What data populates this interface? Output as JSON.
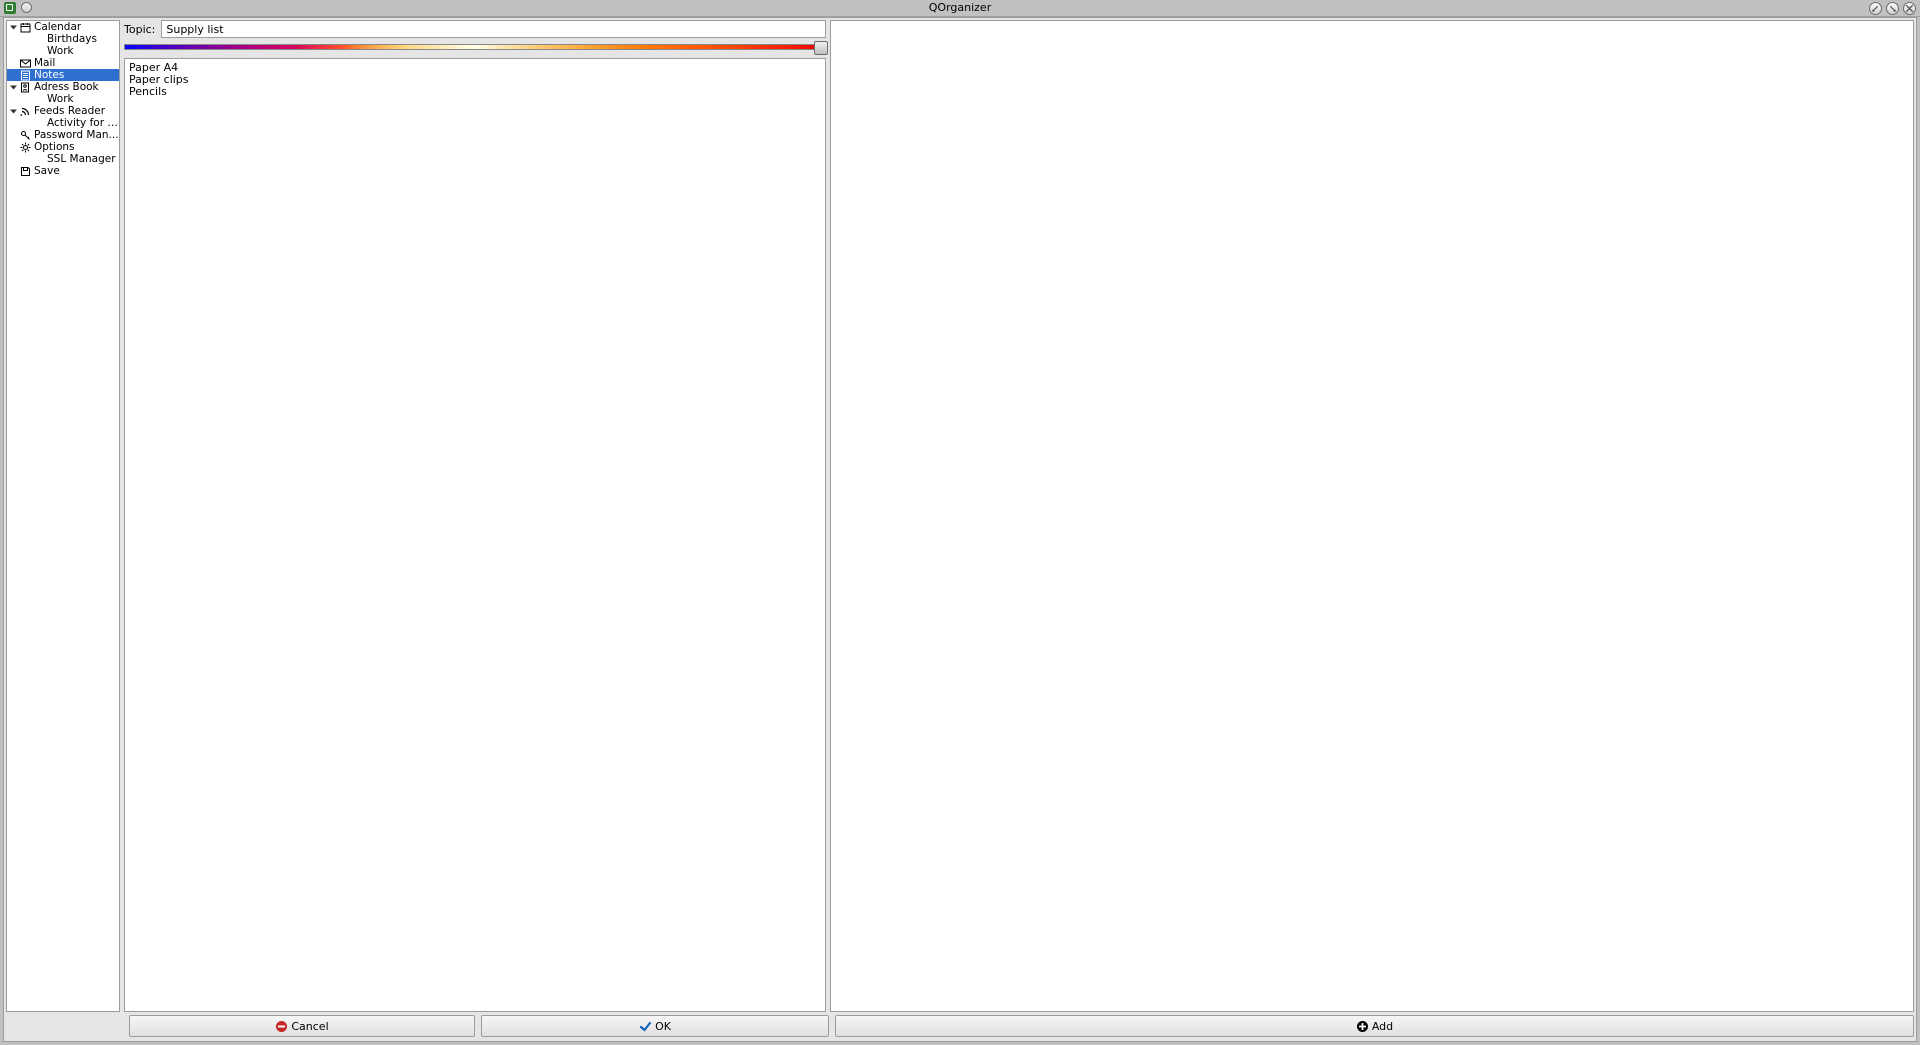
{
  "window": {
    "title": "QOrganizer"
  },
  "tree": {
    "items": [
      {
        "label": "Calendar",
        "level": 0,
        "icon": "calendar",
        "expanded": true
      },
      {
        "label": "Birthdays",
        "level": 1,
        "icon": "",
        "expanded": null
      },
      {
        "label": "Work",
        "level": 1,
        "icon": "",
        "expanded": null
      },
      {
        "label": "Mail",
        "level": 0,
        "icon": "mail",
        "expanded": null
      },
      {
        "label": "Notes",
        "level": 0,
        "icon": "notes",
        "expanded": null,
        "selected": true
      },
      {
        "label": "Adress Book",
        "level": 0,
        "icon": "adress",
        "expanded": true
      },
      {
        "label": "Work",
        "level": 1,
        "icon": "",
        "expanded": null
      },
      {
        "label": "Feeds Reader",
        "level": 0,
        "icon": "feed",
        "expanded": true
      },
      {
        "label": "Activity for QO...",
        "level": 1,
        "icon": "",
        "expanded": null
      },
      {
        "label": "Password Man...",
        "level": 0,
        "icon": "key",
        "expanded": null
      },
      {
        "label": "Options",
        "level": 0,
        "icon": "gear",
        "expanded": null
      },
      {
        "label": "SSL Manager",
        "level": 1,
        "icon": "",
        "expanded": null
      },
      {
        "label": "Save",
        "level": 0,
        "icon": "save",
        "expanded": null
      }
    ]
  },
  "editor": {
    "topic_label": "Topic:",
    "topic_value": "Supply list",
    "body": "Paper A4\nPaper clips\nPencils"
  },
  "buttons": {
    "cancel": "Cancel",
    "ok": "OK",
    "add": "Add"
  }
}
